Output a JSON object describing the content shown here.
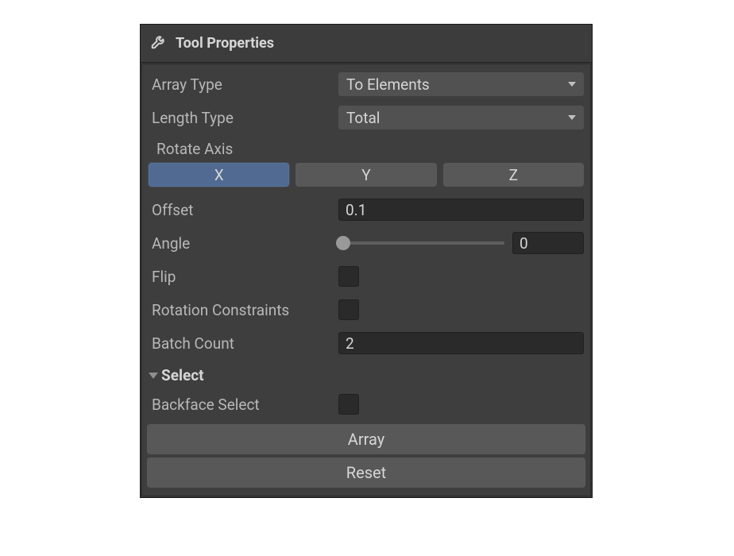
{
  "header": {
    "icon": "wrench-icon",
    "title": "Tool Properties"
  },
  "properties": {
    "array_type": {
      "label": "Array Type",
      "value": "To Elements"
    },
    "length_type": {
      "label": "Length Type",
      "value": "Total"
    },
    "rotate_axis": {
      "label": "Rotate Axis",
      "options": [
        "X",
        "Y",
        "Z"
      ],
      "selected": "X"
    },
    "offset": {
      "label": "Offset",
      "value": "0.1"
    },
    "angle": {
      "label": "Angle",
      "value": "0",
      "slider_min": 0,
      "slider_max": 360,
      "slider_pos_percent": 3
    },
    "flip": {
      "label": "Flip",
      "checked": false
    },
    "rotation_constraints": {
      "label": "Rotation Constraints",
      "checked": false
    },
    "batch_count": {
      "label": "Batch Count",
      "value": "2"
    }
  },
  "sections": {
    "select": {
      "title": "Select",
      "expanded": true,
      "backface_select": {
        "label": "Backface Select",
        "checked": false
      }
    }
  },
  "buttons": {
    "array": "Array",
    "reset": "Reset"
  }
}
